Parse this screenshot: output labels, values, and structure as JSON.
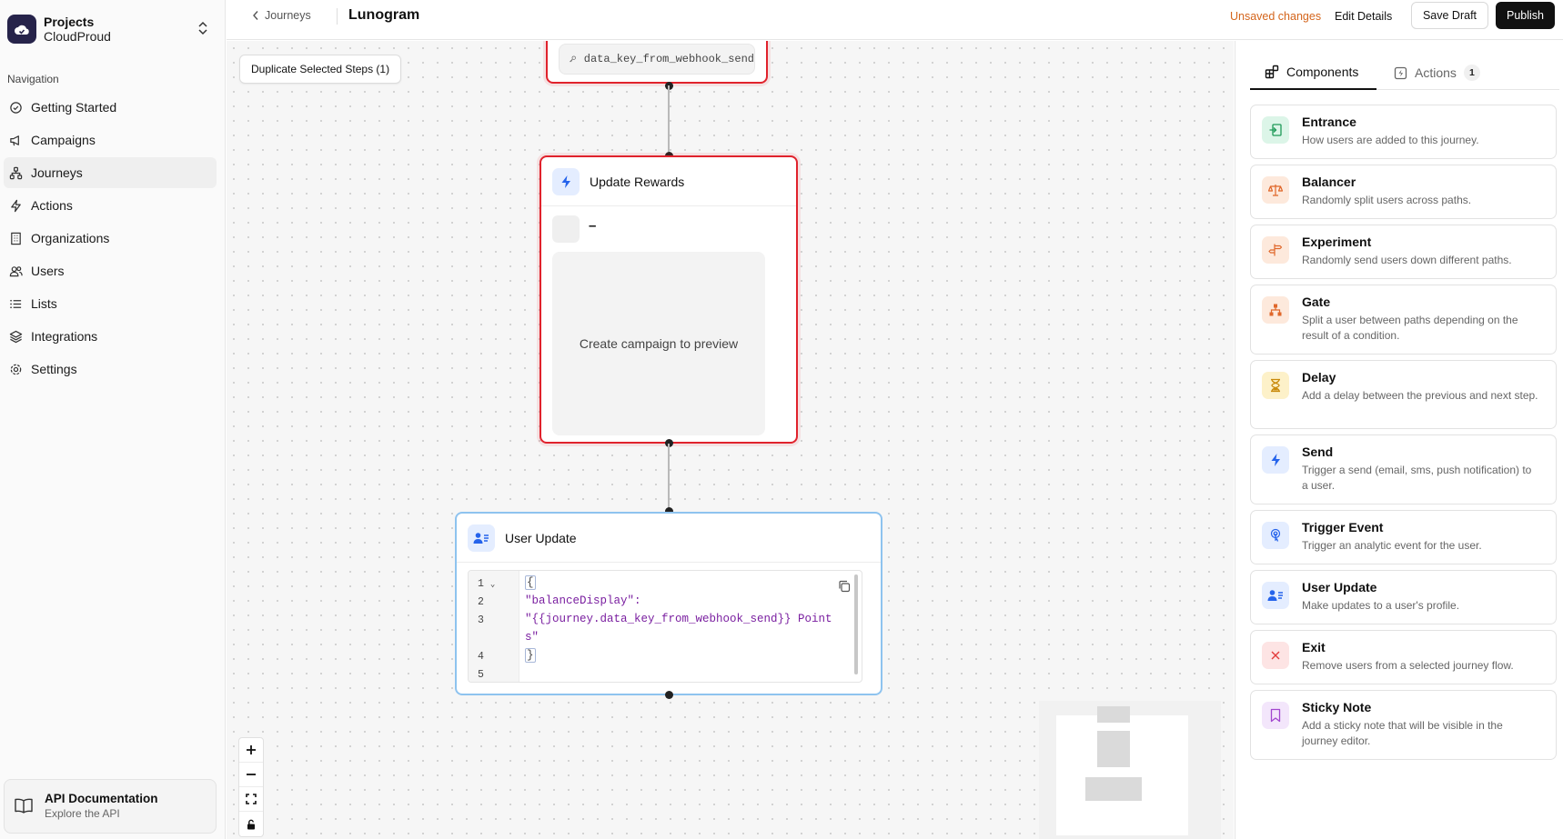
{
  "project": {
    "title": "Projects",
    "name": "CloudProud"
  },
  "nav": {
    "heading": "Navigation",
    "items": [
      {
        "label": "Getting Started",
        "icon": "check-circle-icon"
      },
      {
        "label": "Campaigns",
        "icon": "megaphone-icon"
      },
      {
        "label": "Journeys",
        "icon": "journeys-icon",
        "active": true
      },
      {
        "label": "Actions",
        "icon": "bolt-icon"
      },
      {
        "label": "Organizations",
        "icon": "building-icon"
      },
      {
        "label": "Users",
        "icon": "users-icon"
      },
      {
        "label": "Lists",
        "icon": "list-icon"
      },
      {
        "label": "Integrations",
        "icon": "layers-icon"
      },
      {
        "label": "Settings",
        "icon": "gear-icon"
      }
    ]
  },
  "api_card": {
    "title": "API Documentation",
    "subtitle": "Explore the API"
  },
  "header": {
    "back_label": "Journeys",
    "title": "Lunogram",
    "unsaved": "Unsaved changes",
    "edit_details": "Edit Details",
    "save_draft": "Save Draft",
    "publish": "Publish"
  },
  "canvas": {
    "duplicate_button": "Duplicate Selected Steps (1)",
    "top_node_key": "data_key_from_webhook_send",
    "update_rewards": {
      "title": "Update Rewards",
      "dash": "–",
      "preview": "Create campaign to preview"
    },
    "user_update": {
      "title": "User Update",
      "line_numbers": [
        "1",
        "2",
        "3",
        "",
        "4",
        "5"
      ],
      "code_lines": [
        "{",
        "\"balanceDisplay\":",
        "\"{{journey.data_key_from_webhook_send}} Point",
        "s\"",
        "}",
        ""
      ]
    }
  },
  "panel": {
    "tabs": [
      {
        "label": "Components",
        "active": true
      },
      {
        "label": "Actions",
        "count": "1"
      }
    ],
    "components": [
      {
        "title": "Entrance",
        "desc": "How users are added to this journey.",
        "icon": "entrance-icon",
        "bg": "#dcf5e8",
        "fg": "#1f9a58"
      },
      {
        "title": "Balancer",
        "desc": "Randomly split users across paths.",
        "icon": "balance-scale-icon",
        "bg": "#fde9dc",
        "fg": "#e0672a"
      },
      {
        "title": "Experiment",
        "desc": "Randomly send users down different paths.",
        "icon": "signpost-icon",
        "bg": "#fde9dc",
        "fg": "#e0672a"
      },
      {
        "title": "Gate",
        "desc": "Split a user between paths depending on the result of a condition.",
        "icon": "gate-split-icon",
        "bg": "#fde9dc",
        "fg": "#e0672a"
      },
      {
        "title": "Delay",
        "desc": "Add a delay between the previous and next step.",
        "icon": "hourglass-icon",
        "bg": "#fdf1c9",
        "fg": "#c98a0b"
      },
      {
        "title": "Send",
        "desc": "Trigger a send (email, sms, push notification) to a user.",
        "icon": "bolt-icon",
        "bg": "#e4edff",
        "fg": "#2563eb"
      },
      {
        "title": "Trigger Event",
        "desc": "Trigger an analytic event for the user.",
        "icon": "touch-icon",
        "bg": "#e4edff",
        "fg": "#2563eb"
      },
      {
        "title": "User Update",
        "desc": "Make updates to a user's profile.",
        "icon": "user-card-icon",
        "bg": "#e4edff",
        "fg": "#2563eb"
      },
      {
        "title": "Exit",
        "desc": "Remove users from a selected journey flow.",
        "icon": "close-icon",
        "bg": "#fde4e4",
        "fg": "#e23c3c"
      },
      {
        "title": "Sticky Note",
        "desc": "Add a sticky note that will be visible in the journey editor.",
        "icon": "bookmark-icon",
        "bg": "#f3e6fb",
        "fg": "#a247cf"
      }
    ]
  }
}
